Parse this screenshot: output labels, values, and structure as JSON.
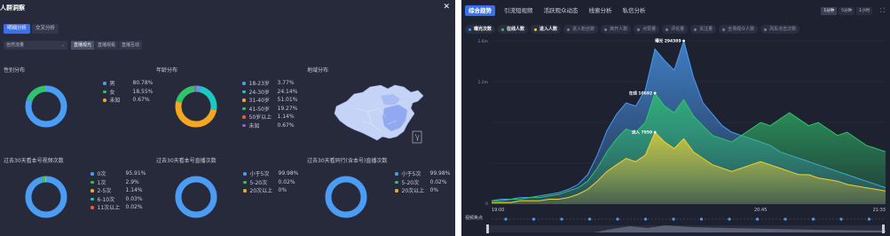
{
  "left_panel": {
    "title": "人群洞察",
    "tabs": [
      {
        "label": "明细分析",
        "active": true
      },
      {
        "label": "交叉分析",
        "active": false
      }
    ],
    "filter": {
      "select_value": "自然流量",
      "segments": [
        {
          "label": "直播观光",
          "active": true
        },
        {
          "label": "直播观看",
          "active": false
        },
        {
          "label": "直播互动",
          "active": false
        }
      ]
    },
    "gender": {
      "title": "性别分布",
      "items": [
        {
          "name": "男",
          "pct": "80.78%",
          "value": 80.78,
          "color": "#4a9cf5"
        },
        {
          "name": "女",
          "pct": "18.55%",
          "value": 18.55,
          "color": "#2fc46b"
        },
        {
          "name": "未知",
          "pct": "0.67%",
          "value": 0.67,
          "color": "#f5a623"
        }
      ]
    },
    "age": {
      "title": "年龄分布",
      "items": [
        {
          "name": "18-23岁",
          "pct": "3.77%",
          "value": 3.77,
          "color": "#4a9cf5"
        },
        {
          "name": "24-30岁",
          "pct": "24.14%",
          "value": 24.14,
          "color": "#1ec8c0"
        },
        {
          "name": "31-40岁",
          "pct": "51.01%",
          "value": 51.01,
          "color": "#f5a623"
        },
        {
          "name": "41-50岁",
          "pct": "19.27%",
          "value": 19.27,
          "color": "#2fc46b"
        },
        {
          "name": "50岁以上",
          "pct": "1.14%",
          "value": 1.14,
          "color": "#e85d3d"
        },
        {
          "name": "未知",
          "pct": "0.67%",
          "value": 0.67,
          "color": "#8a63d2"
        }
      ]
    },
    "region": {
      "title": "地域分布"
    },
    "watch30": {
      "title": "过去30天看本号视频次数",
      "items": [
        {
          "name": "0次",
          "pct": "95.91%",
          "value": 95.91,
          "color": "#4a9cf5"
        },
        {
          "name": "1次",
          "pct": "2.9%",
          "value": 2.9,
          "color": "#2fc46b"
        },
        {
          "name": "2-5次",
          "pct": "1.14%",
          "value": 1.14,
          "color": "#f5a623"
        },
        {
          "name": "6-10次",
          "pct": "0.03%",
          "value": 0.03,
          "color": "#1ec8c0"
        },
        {
          "name": "11次以上",
          "pct": "0.02%",
          "value": 0.02,
          "color": "#e85d3d"
        }
      ]
    },
    "live30": {
      "title": "过去30天看本号直播次数",
      "items": [
        {
          "name": "小于5次",
          "pct": "99.98%",
          "value": 99.98,
          "color": "#4a9cf5"
        },
        {
          "name": "5-20次",
          "pct": "0.02%",
          "value": 0.02,
          "color": "#2fc46b"
        },
        {
          "name": "20次以上",
          "pct": "0%",
          "value": 0,
          "color": "#f5a623"
        }
      ]
    },
    "peer30": {
      "title": "过去30天看同行(含本号)直播次数",
      "items": [
        {
          "name": "小于5次",
          "pct": "99.98%",
          "value": 99.98,
          "color": "#4a9cf5"
        },
        {
          "name": "5-20次",
          "pct": "0.02%",
          "value": 0.02,
          "color": "#2fc46b"
        },
        {
          "name": "20次以上",
          "pct": "0%",
          "value": 0,
          "color": "#f5a623"
        }
      ]
    }
  },
  "right_panel": {
    "tabs": [
      {
        "label": "综合趋势",
        "active": true
      },
      {
        "label": "引流短视频",
        "active": false
      },
      {
        "label": "活跃观众动态",
        "active": false
      },
      {
        "label": "线索分析",
        "active": false
      },
      {
        "label": "私信分析",
        "active": false
      }
    ],
    "time_segments": [
      {
        "label": "1分钟",
        "active": true
      },
      {
        "label": "5分钟",
        "active": false
      },
      {
        "label": "1小时",
        "active": false
      }
    ],
    "metrics": [
      {
        "label": "曝光次数",
        "on": true,
        "color": "#4a9cf5"
      },
      {
        "label": "在线人数",
        "on": true,
        "color": "#2fc46b"
      },
      {
        "label": "进入人数",
        "on": true,
        "color": "#f5d033"
      },
      {
        "label": "进入粉丝数",
        "on": false,
        "color": "#7a8095"
      },
      {
        "label": "离开人数",
        "on": false,
        "color": "#7a8095"
      },
      {
        "label": "点赞量",
        "on": false,
        "color": "#7a8095"
      },
      {
        "label": "评论量",
        "on": false,
        "color": "#7a8095"
      },
      {
        "label": "关注量",
        "on": false,
        "color": "#7a8095"
      },
      {
        "label": "全场观众人数",
        "on": false,
        "color": "#7a8095"
      },
      {
        "label": "风车点击次数",
        "on": false,
        "color": "#7a8095"
      }
    ],
    "bottom_label": "视频焦点"
  },
  "chart_data": {
    "type": "area",
    "x": [
      "19:00",
      "20:45",
      "21:33"
    ],
    "y_ticks_left": [
      "1.6m",
      "1.2m",
      "0"
    ],
    "series": [
      {
        "name": "曝光次数",
        "color": "#4a9cf5",
        "values": [
          2,
          3,
          3,
          4,
          4,
          5,
          6,
          7,
          9,
          12,
          18,
          30,
          45,
          55,
          62,
          60,
          70,
          95,
          88,
          82,
          100,
          78,
          62,
          55,
          48,
          44,
          42,
          40,
          38,
          36,
          32,
          30,
          28,
          26,
          24,
          22,
          20,
          18,
          16,
          14,
          12,
          10
        ]
      },
      {
        "name": "在线人数",
        "color": "#2fc46b",
        "values": [
          2,
          2,
          3,
          3,
          4,
          4,
          5,
          6,
          8,
          10,
          14,
          22,
          32,
          40,
          46,
          44,
          50,
          68,
          60,
          56,
          64,
          54,
          48,
          42,
          40,
          38,
          42,
          46,
          50,
          48,
          52,
          56,
          52,
          48,
          50,
          46,
          42,
          44,
          40,
          36,
          34,
          32
        ]
      },
      {
        "name": "进入人数",
        "color": "#f5d033",
        "values": [
          1,
          1,
          1,
          2,
          2,
          2,
          3,
          3,
          4,
          6,
          9,
          14,
          20,
          24,
          28,
          26,
          30,
          44,
          38,
          34,
          40,
          32,
          28,
          24,
          22,
          20,
          22,
          24,
          26,
          24,
          22,
          20,
          18,
          18,
          16,
          15,
          14,
          12,
          11,
          10,
          9,
          8
        ]
      }
    ],
    "annotations": [
      {
        "label": "曝光 294389"
      },
      {
        "label": "在线 10692"
      },
      {
        "label": "进入 7859"
      }
    ]
  }
}
